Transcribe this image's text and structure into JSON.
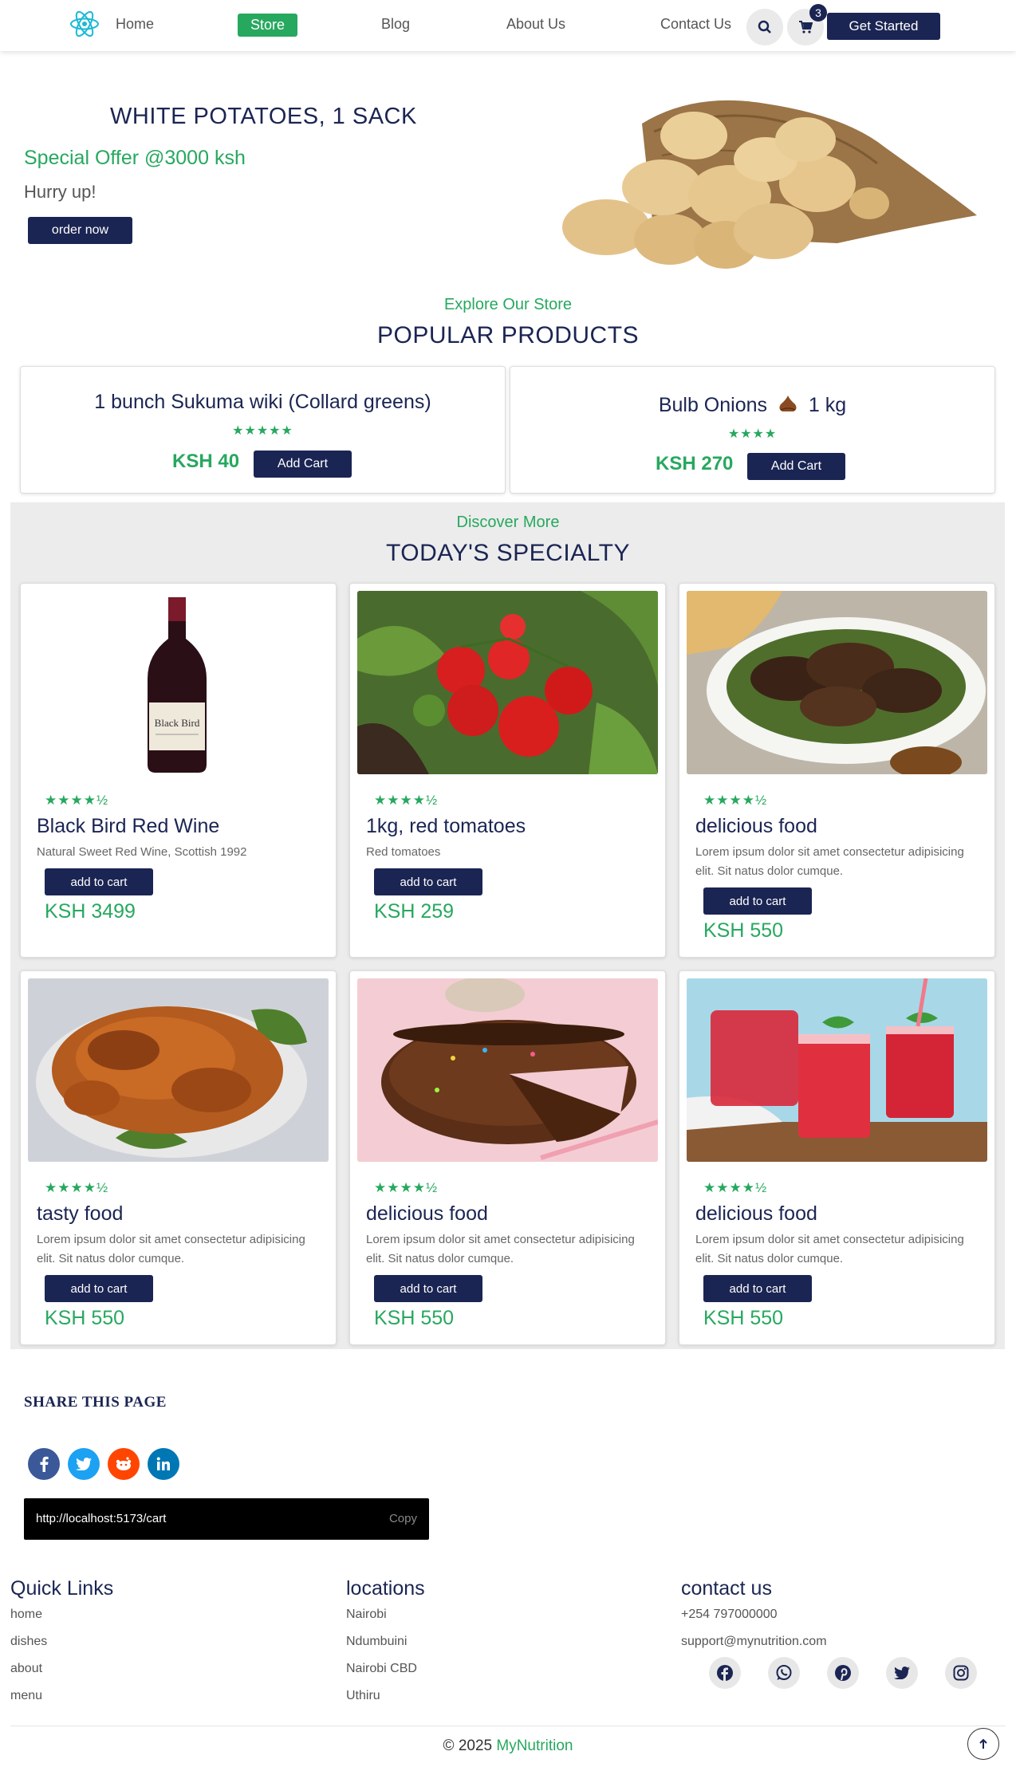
{
  "nav": {
    "links": [
      "Home",
      "Store",
      "Blog",
      "About Us",
      "Contact Us"
    ],
    "cart_count": "3",
    "cta": "Get Started"
  },
  "hero": {
    "title": "WHITE POTATOES, 1 SACK",
    "offer": "Special Offer @3000 ksh",
    "hurry": "Hurry up!",
    "button": "order now"
  },
  "popular": {
    "subtitle": "Explore Our Store",
    "title": "POPULAR PRODUCTS",
    "items": [
      {
        "name": "1 bunch Sukuma wiki (Collard greens)",
        "stars": "★★★★★",
        "price": "KSH 40",
        "button": "Add Cart"
      },
      {
        "name_a": "Bulb Onions",
        "name_b": "1 kg",
        "stars": "★★★★",
        "price": "KSH 270",
        "button": "Add Cart"
      }
    ]
  },
  "specialty": {
    "subtitle": "Discover More",
    "title": "TODAY'S SPECIALTY",
    "items": [
      {
        "name": "Black Bird Red Wine",
        "desc": "Natural Sweet Red Wine, Scottish 1992",
        "button": "add to cart",
        "price": "KSH 3499",
        "stars": "★★★★½",
        "image": "wine-bottle"
      },
      {
        "name": "1kg, red tomatoes",
        "desc": "Red tomatoes",
        "button": "add to cart",
        "price": "KSH 259",
        "stars": "★★★★½",
        "image": "tomatoes"
      },
      {
        "name": "delicious food",
        "desc": "Lorem ipsum dolor sit amet consectetur adipisicing elit. Sit natus dolor cumque.",
        "button": "add to cart",
        "price": "KSH 550",
        "stars": "★★★★½",
        "image": "grilled-chicken"
      },
      {
        "name": "tasty food",
        "desc": "Lorem ipsum dolor sit amet consectetur adipisicing elit. Sit natus dolor cumque.",
        "button": "add to cart",
        "price": "KSH 550",
        "stars": "★★★★½",
        "image": "roast-chicken"
      },
      {
        "name": "delicious food",
        "desc": "Lorem ipsum dolor sit amet consectetur adipisicing elit. Sit natus dolor cumque.",
        "button": "add to cart",
        "price": "KSH 550",
        "stars": "★★★★½",
        "image": "chocolate-cake"
      },
      {
        "name": "delicious food",
        "desc": "Lorem ipsum dolor sit amet consectetur adipisicing elit. Sit natus dolor cumque.",
        "button": "add to cart",
        "price": "KSH 550",
        "stars": "★★★★½",
        "image": "red-drinks"
      }
    ]
  },
  "share": {
    "title": "SHARE THIS PAGE",
    "url": "http://localhost:5173/cart",
    "copy": "Copy",
    "icons": [
      "facebook-icon",
      "twitter-icon",
      "reddit-icon",
      "linkedin-icon"
    ]
  },
  "footer": {
    "quick_links": {
      "title": "Quick Links",
      "items": [
        "home",
        "dishes",
        "about",
        "menu"
      ]
    },
    "locations": {
      "title": "locations",
      "items": [
        "Nairobi",
        "Ndumbuini",
        "Nairobi CBD",
        "Uthiru"
      ]
    },
    "contact": {
      "title": "contact us",
      "phone": "+254 797000000",
      "email": "support@mynutrition.com"
    },
    "social_icons": [
      "facebook-icon",
      "whatsapp-icon",
      "pinterest-icon",
      "twitter-icon",
      "instagram-icon"
    ],
    "copyright_prefix": "© 2025",
    "brand": "MyNutrition"
  },
  "colors": {
    "navy": "#1b2553",
    "green": "#27a85f",
    "section_bg": "#ececec"
  }
}
